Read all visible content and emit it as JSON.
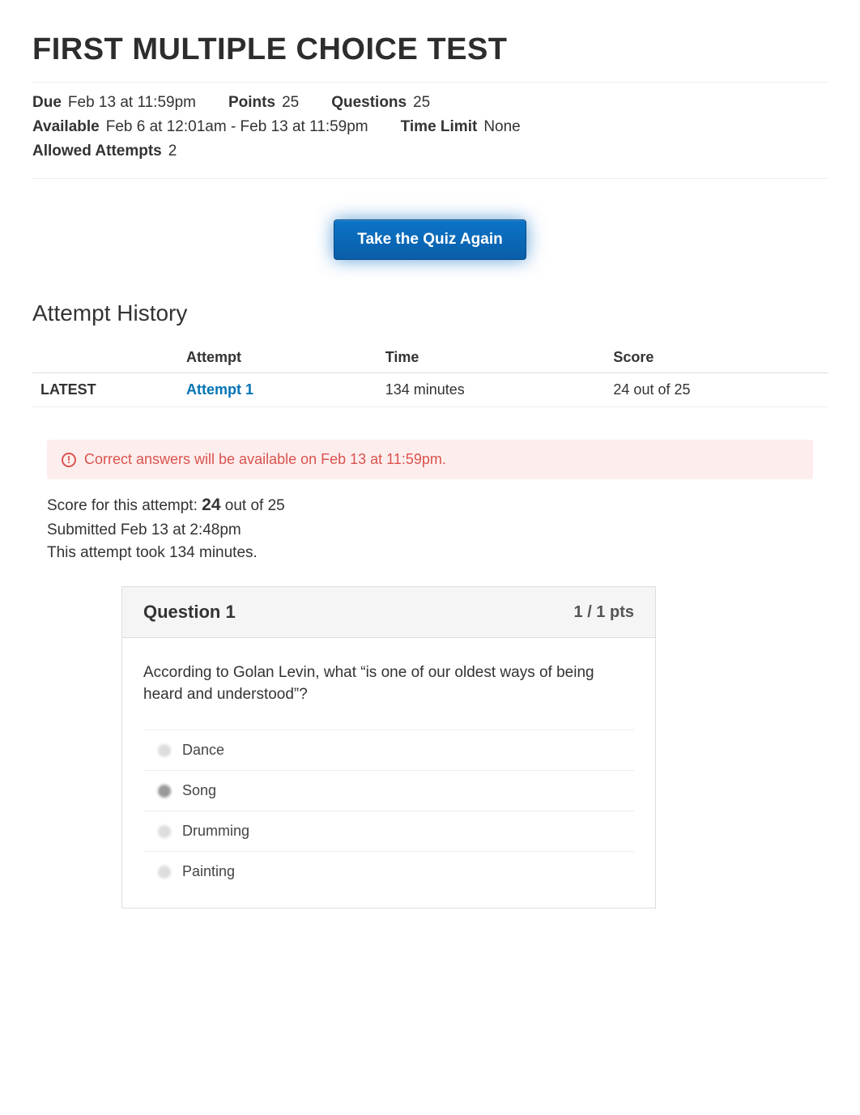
{
  "title": "FIRST MULTIPLE CHOICE TEST",
  "meta": {
    "due_label": "Due",
    "due_value": "Feb 13 at 11:59pm",
    "points_label": "Points",
    "points_value": "25",
    "questions_label": "Questions",
    "questions_value": "25",
    "available_label": "Available",
    "available_value": "Feb 6 at 12:01am - Feb 13 at 11:59pm",
    "timelimit_label": "Time Limit",
    "timelimit_value": "None",
    "attempts_label": "Allowed Attempts",
    "attempts_value": "2"
  },
  "take_again_label": "Take the Quiz Again",
  "attempt_history_heading": "Attempt History",
  "history_headers": {
    "col0": "",
    "attempt": "Attempt",
    "time": "Time",
    "score": "Score"
  },
  "history_row": {
    "latest": "LATEST",
    "attempt": "Attempt 1",
    "time": "134 minutes",
    "score": "24 out of 25"
  },
  "alert_text": "Correct answers will be available on Feb 13 at 11:59pm.",
  "score_prefix": "Score for this attempt: ",
  "score_value": "24",
  "score_suffix": " out of 25",
  "submitted_line": "Submitted Feb 13 at 2:48pm",
  "duration_line": "This attempt took 134 minutes.",
  "question": {
    "title": "Question 1",
    "points": "1 / 1 pts",
    "text": "According to Golan Levin, what “is one of our oldest ways of being heard and understood”?",
    "answers": [
      "Dance",
      "Song",
      "Drumming",
      "Painting"
    ],
    "selected_index": 1
  }
}
